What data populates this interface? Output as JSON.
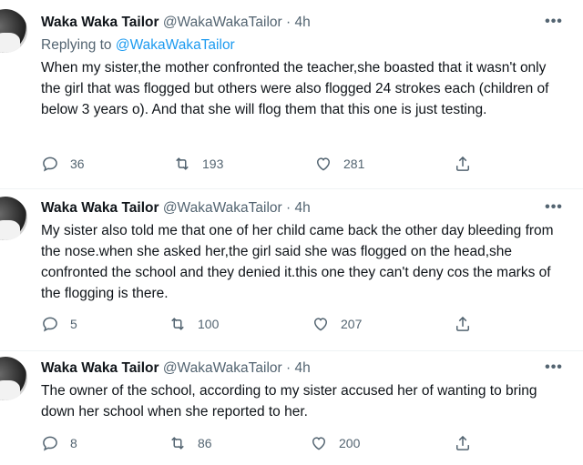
{
  "tweets": [
    {
      "name": "Waka Waka Tailor",
      "handle": "@WakaWakaTailor",
      "sep": "·",
      "time": "4h",
      "replying_prefix": "Replying to ",
      "replying_handle": "@WakaWakaTailor",
      "text": "When my sister,the mother confronted the teacher,she boasted that it wasn't only the girl that was flogged but others were also flogged 24 strokes each (children of below 3 years o). And that she will flog them that this one is just testing.",
      "replies": "36",
      "retweets": "193",
      "likes": "281"
    },
    {
      "name": "Waka Waka Tailor",
      "handle": "@WakaWakaTailor",
      "sep": "·",
      "time": "4h",
      "text": "My sister also told me that one of her child came back the other day bleeding from the nose.when she asked her,the girl said she was flogged on the head,she confronted the school and they denied it.this one they can't deny cos the marks of the flogging is there.",
      "replies": "5",
      "retweets": "100",
      "likes": "207"
    },
    {
      "name": "Waka Waka Tailor",
      "handle": "@WakaWakaTailor",
      "sep": "·",
      "time": "4h",
      "text": "The owner of the school, according to my sister accused her of wanting to bring down her school when she reported to her.",
      "replies": "8",
      "retweets": "86",
      "likes": "200"
    }
  ],
  "more_glyph": "•••"
}
